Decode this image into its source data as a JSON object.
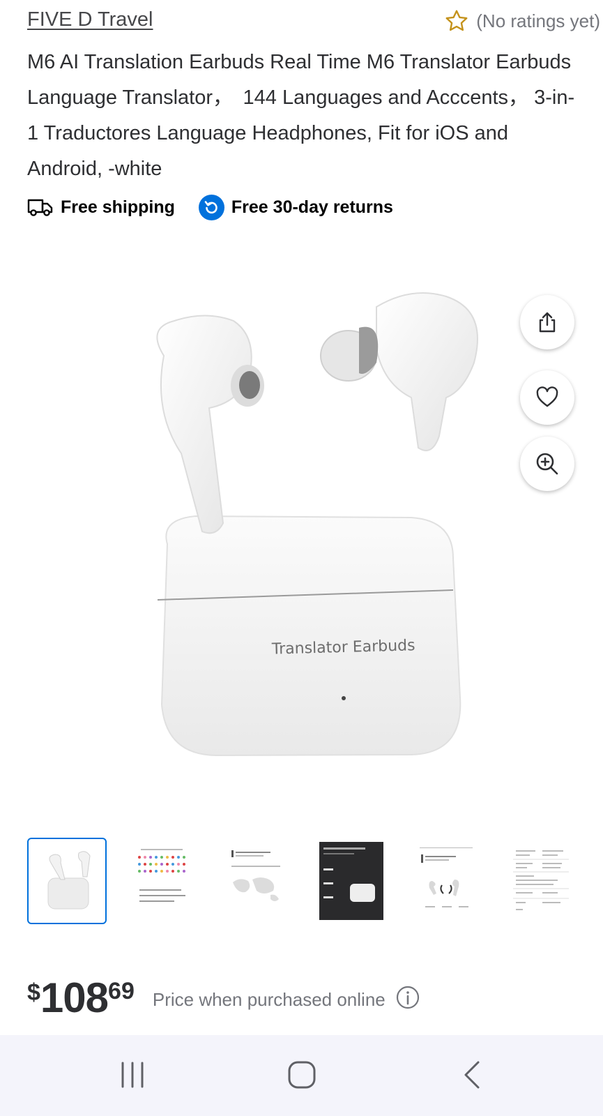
{
  "store": {
    "brand": "FIVE D Travel",
    "rating_text": "(No ratings yet)",
    "star_color": "#c4921b"
  },
  "product": {
    "title": "M6 AI Translation Earbuds Real Time M6 Translator Earbuds Language Translator，　144 Languages and Acccents， 3-in-1 Traductores Language Headphones, Fit for iOS and Android, -white",
    "case_print": "Translator Earbuds"
  },
  "perks": {
    "shipping": {
      "icon": "truck-icon",
      "label": "Free shipping"
    },
    "returns": {
      "icon": "return-arrow-icon",
      "label": "Free 30-day returns"
    }
  },
  "actions": {
    "share": "share-icon",
    "favorite": "heart-icon",
    "zoom": "zoom-in-icon"
  },
  "gallery": {
    "selected_index": 0,
    "thumbnails": [
      "earbuds-and-case",
      "language-color-grid",
      "world-map",
      "battery-life-dark",
      "earbuds-specs",
      "spec-table"
    ]
  },
  "price": {
    "currency": "$",
    "dollars": "108",
    "cents": "69",
    "note": "Price when purchased online"
  },
  "navbar": {
    "recent": "recent-apps-icon",
    "home": "home-icon",
    "back": "back-icon"
  },
  "colors": {
    "accent": "#0071dc",
    "text": "#2e2f32",
    "muted": "#74767c",
    "navbar_bg": "#f4f4fb"
  }
}
